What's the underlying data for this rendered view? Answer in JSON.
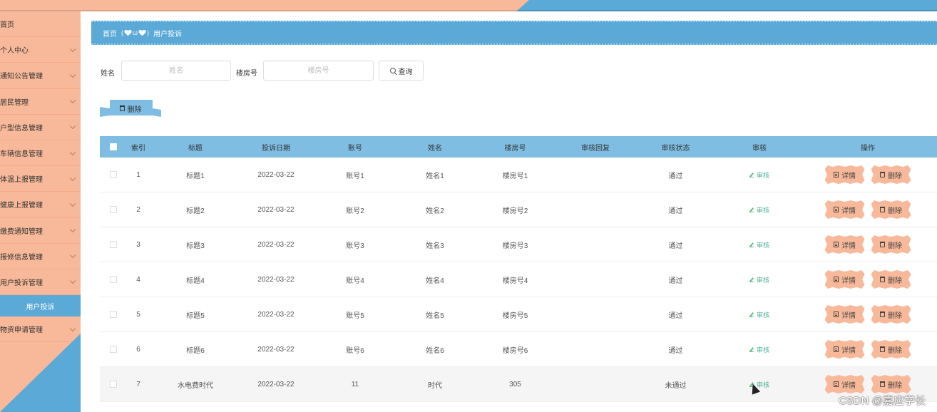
{
  "sidebar": {
    "items": [
      {
        "label": "首页",
        "has_children": false
      },
      {
        "label": "个人中心",
        "has_children": true
      },
      {
        "label": "通知公告管理",
        "has_children": true
      },
      {
        "label": "居民管理",
        "has_children": true
      },
      {
        "label": "户型信息管理",
        "has_children": true
      },
      {
        "label": "车辆信息管理",
        "has_children": true
      },
      {
        "label": "体温上报管理",
        "has_children": true
      },
      {
        "label": "健康上报管理",
        "has_children": true
      },
      {
        "label": "缴费通知管理",
        "has_children": true
      },
      {
        "label": "报修信息管理",
        "has_children": true
      },
      {
        "label": "用户投诉管理",
        "has_children": true
      }
    ],
    "active_sub": "用户投诉",
    "after_items": [
      {
        "label": "物资申请管理",
        "has_children": true
      }
    ]
  },
  "breadcrumb": {
    "home": "首页",
    "separator_text": "ω",
    "current": "用户投诉"
  },
  "search": {
    "name_label": "姓名",
    "name_placeholder": "姓名",
    "room_label": "楼房号",
    "room_placeholder": "楼房号",
    "query_button": "查询"
  },
  "toolbar": {
    "delete_button": "删除"
  },
  "table": {
    "headers": [
      "索引",
      "标题",
      "投诉日期",
      "账号",
      "姓名",
      "楼房号",
      "审核回复",
      "审核状态",
      "审核",
      "操作"
    ],
    "rows": [
      {
        "index": "1",
        "title": "标题1",
        "date": "2022-03-22",
        "account": "账号1",
        "name": "姓名1",
        "room": "楼房号1",
        "reply": "",
        "status": "通过"
      },
      {
        "index": "2",
        "title": "标题2",
        "date": "2022-03-22",
        "account": "账号2",
        "name": "姓名2",
        "room": "楼房号2",
        "reply": "",
        "status": "通过"
      },
      {
        "index": "3",
        "title": "标题3",
        "date": "2022-03-22",
        "account": "账号3",
        "name": "姓名3",
        "room": "楼房号3",
        "reply": "",
        "status": "通过"
      },
      {
        "index": "4",
        "title": "标题4",
        "date": "2022-03-22",
        "account": "账号4",
        "name": "姓名4",
        "room": "楼房号4",
        "reply": "",
        "status": "通过"
      },
      {
        "index": "5",
        "title": "标题5",
        "date": "2022-03-22",
        "account": "账号5",
        "name": "姓名5",
        "room": "楼房号5",
        "reply": "",
        "status": "通过"
      },
      {
        "index": "6",
        "title": "标题6",
        "date": "2022-03-22",
        "account": "账号6",
        "name": "姓名6",
        "room": "楼房号6",
        "reply": "",
        "status": "通过"
      },
      {
        "index": "7",
        "title": "水电费时代",
        "date": "2022-03-22",
        "account": "11",
        "name": "时代",
        "room": "305",
        "reply": "",
        "status": "未通过"
      }
    ],
    "audit_label": "审核",
    "detail_label": "详情",
    "delete_label": "删除"
  },
  "watermark": "CSDN @嘉应学长",
  "colors": {
    "peach": "#f8b99a",
    "blue": "#5aa9d6",
    "header_blue": "#7fbde3",
    "audit_green": "#4fb39a"
  }
}
